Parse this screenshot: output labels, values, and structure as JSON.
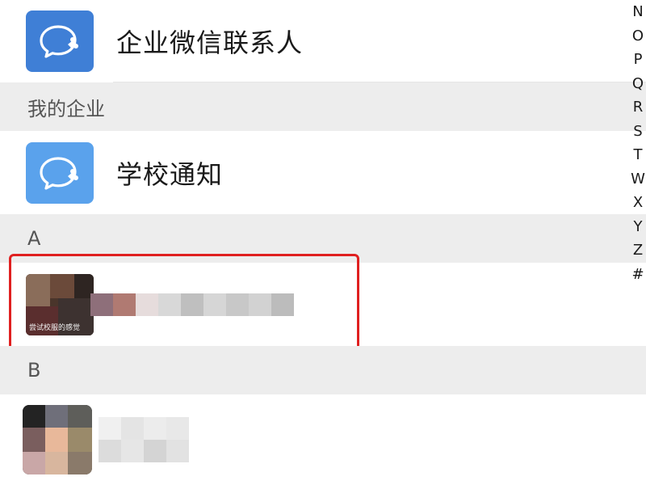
{
  "top_item": {
    "label": "企业微信联系人",
    "icon": "wecom-chat-icon",
    "icon_color": "#3f7fd6"
  },
  "section_my_enterprise": {
    "title": "我的企业"
  },
  "school_item": {
    "label": "学校通知",
    "icon": "wecom-chat-icon",
    "icon_color": "#5aa2ec"
  },
  "section_a": {
    "title": "A"
  },
  "contact_a": {
    "avatar_caption": "尝试校服的感觉",
    "name_hidden": true
  },
  "section_b": {
    "title": "B"
  },
  "contact_b": {
    "name_hidden": true
  },
  "alphabet_index": [
    "N",
    "O",
    "P",
    "Q",
    "R",
    "S",
    "T",
    "W",
    "X",
    "Y",
    "Z",
    "#"
  ],
  "colors": {
    "highlight": "#e02020",
    "section_bg": "#ededed"
  }
}
